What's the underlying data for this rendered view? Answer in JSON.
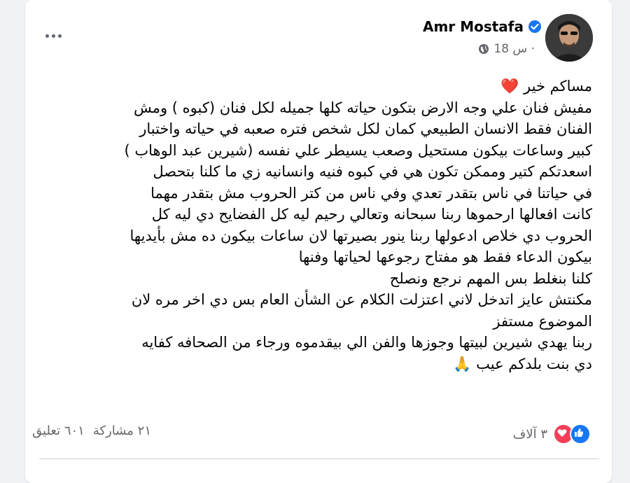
{
  "post": {
    "author": "Amr Mostafa",
    "time": "18 س ·",
    "lines": [
      "مساكم خير ❤️",
      "مفيش فنان علي وجه الارض بتكون حياته كلها جميله لكل فنان (كبوه ) ومش",
      "الفنان فقط الانسان الطبيعي كمان لكل شخص فتره صعبه في حياته واختبار",
      "كبير وساعات بيكون مستحيل وصعب يسيطر علي نفسه (شيرين عبد الوهاب )",
      "اسعدتكم كتير وممكن تكون هي في كبوه فنيه   وانسانيه زي ما كلنا بتحصل",
      "في حياتنا في ناس بتقدر تعدي وفي ناس من كتر الحروب مش بتقدر  مهما",
      "كانت افعالها ارحموها ربنا سبحانه وتعالي رحيم ليه كل الفضايح دي ليه كل",
      "الحروب دي خلاص ادعولها ربنا ينور بصيرتها لان ساعات بيكون ده مش بأيديها",
      "بيكون الدعاء فقط هو مفتاح رجوعها لحياتها وفنها",
      "كلنا بنغلط بس المهم نرجع ونصلح",
      "مكنتش عايز اتدخل لاني اعتزلت الكلام عن الشأن العام بس دي اخر مره لان",
      "الموضوع مستفز",
      "ربنا يهدي شيرين لبيتها وجوزها  والفن الي بيقدموه ورجاء من الصحافه كفايه",
      "دي بنت بلدكم عيب 🙏"
    ]
  },
  "footer": {
    "reactions": "٣ آلاف",
    "comments": "٦٠١ تعليق",
    "shares": "٢١ مشاركة"
  },
  "colors": {
    "like": "#1877f2",
    "love": "#f33e58",
    "verified": "#1877f2",
    "muted": "#65676b"
  },
  "icons": [
    "verified-badge-icon",
    "globe-icon",
    "more-options-icon",
    "like-reaction-icon",
    "love-reaction-icon"
  ]
}
